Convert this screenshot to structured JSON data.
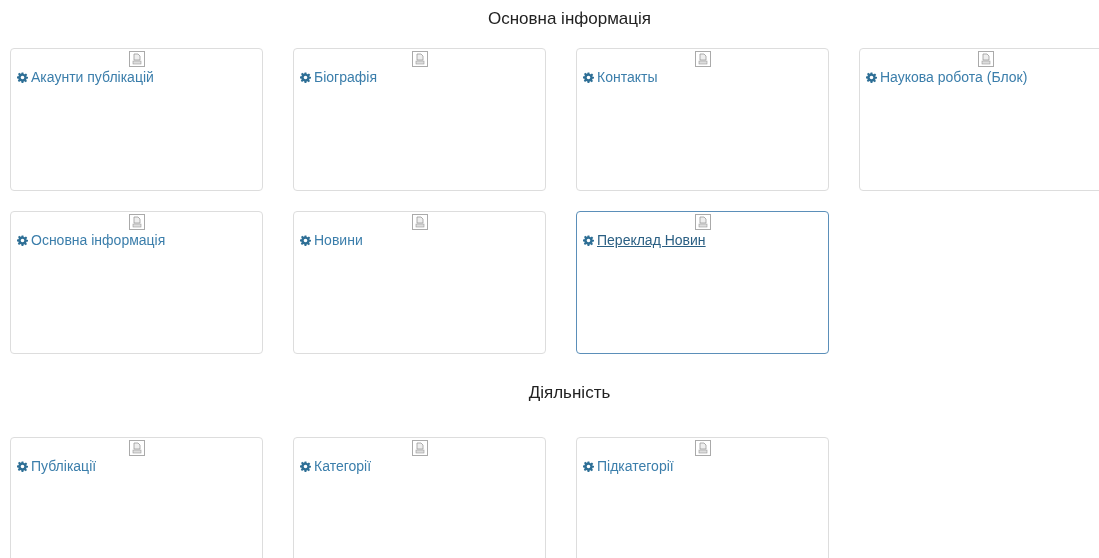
{
  "sections": [
    {
      "title": "Основна інформація",
      "cards": [
        {
          "label": "Акаунти публікацій",
          "selected": false
        },
        {
          "label": "Біографія",
          "selected": false
        },
        {
          "label": "Контакты",
          "selected": false
        },
        {
          "label": "Наукова робота (Блок)",
          "selected": false
        },
        {
          "label": "Основна інформація",
          "selected": false
        },
        {
          "label": "Новини",
          "selected": false
        },
        {
          "label": "Переклад Новин",
          "selected": true
        }
      ]
    },
    {
      "title": "Діяльність",
      "cards": [
        {
          "label": "Публікації",
          "selected": false
        },
        {
          "label": "Категорії",
          "selected": false
        },
        {
          "label": "Підкатегорії",
          "selected": false
        }
      ]
    }
  ]
}
